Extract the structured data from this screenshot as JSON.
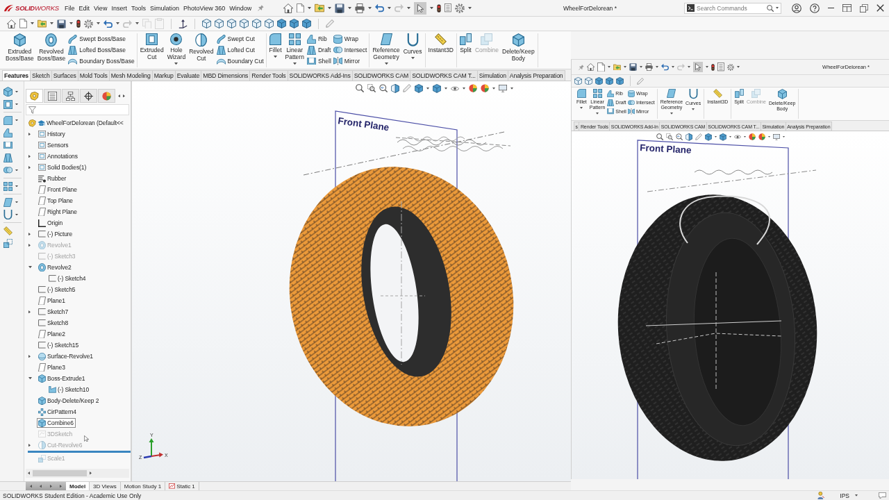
{
  "title_bar": {
    "logo": "**SOLID**WORKS",
    "menus": [
      "File",
      "Edit",
      "View",
      "Insert",
      "Tools",
      "Simulation",
      "PhotoView 360",
      "Window"
    ],
    "select_tool_active": true,
    "document_title": "WheelForDelorean *",
    "search": {
      "placeholder": "Search Commands"
    }
  },
  "command_manager": {
    "groups": [
      {
        "tools": [
          {
            "kind": "large",
            "label": "Extruded Boss/Base",
            "dropdown": false,
            "disabled": false
          },
          {
            "kind": "large",
            "label": "Revolved Boss/Base",
            "dropdown": false,
            "disabled": false
          },
          {
            "kind": "stack",
            "items": [
              {
                "label": "Swept Boss/Base",
                "disabled": false
              },
              {
                "label": "Lofted Boss/Base",
                "disabled": false
              },
              {
                "label": "Boundary Boss/Base",
                "disabled": false
              }
            ]
          }
        ]
      },
      {
        "tools": [
          {
            "kind": "large",
            "label": "Extruded Cut",
            "dropdown": false,
            "disabled": false
          },
          {
            "kind": "large",
            "label": "Hole Wizard",
            "dropdown": true,
            "disabled": false
          },
          {
            "kind": "large",
            "label": "Revolved Cut",
            "dropdown": false,
            "disabled": false
          },
          {
            "kind": "stack",
            "items": [
              {
                "label": "Swept Cut",
                "disabled": false
              },
              {
                "label": "Lofted Cut",
                "disabled": false
              },
              {
                "label": "Boundary Cut",
                "disabled": false
              }
            ]
          }
        ]
      },
      {
        "tools": [
          {
            "kind": "large",
            "label": "Fillet",
            "dropdown": true,
            "disabled": false
          },
          {
            "kind": "large",
            "label": "Linear Pattern",
            "dropdown": true,
            "disabled": false
          },
          {
            "kind": "stack",
            "items": [
              {
                "label": "Rib",
                "disabled": false
              },
              {
                "label": "Draft",
                "disabled": false
              },
              {
                "label": "Shell",
                "disabled": false
              }
            ]
          },
          {
            "kind": "stack",
            "items": [
              {
                "label": "Wrap",
                "disabled": false
              },
              {
                "label": "Intersect",
                "disabled": false
              },
              {
                "label": "Mirror",
                "disabled": false
              }
            ]
          }
        ]
      },
      {
        "tools": [
          {
            "kind": "large",
            "label": "Reference Geometry",
            "dropdown": true,
            "disabled": false
          },
          {
            "kind": "large",
            "label": "Curves",
            "dropdown": true,
            "disabled": false
          }
        ]
      },
      {
        "tools": [
          {
            "kind": "large",
            "label": "Instant3D",
            "dropdown": false,
            "disabled": false
          }
        ]
      },
      {
        "tools": [
          {
            "kind": "large",
            "label": "Split",
            "dropdown": false,
            "disabled": false
          },
          {
            "kind": "large",
            "label": "Combine",
            "dropdown": false,
            "disabled": true
          },
          {
            "kind": "large",
            "label": "Delete/Keep Body",
            "dropdown": false,
            "disabled": false
          }
        ]
      }
    ]
  },
  "tabs": [
    {
      "label": "Features",
      "selected": true
    },
    {
      "label": "Sketch",
      "selected": false
    },
    {
      "label": "Surfaces",
      "selected": false
    },
    {
      "label": "Mold Tools",
      "selected": false
    },
    {
      "label": "Mesh Modeling",
      "selected": false
    },
    {
      "label": "Markup",
      "selected": false
    },
    {
      "label": "Evaluate",
      "selected": false
    },
    {
      "label": "MBD Dimensions",
      "selected": false
    },
    {
      "label": "Render Tools",
      "selected": false
    },
    {
      "label": "SOLIDWORKS Add-Ins",
      "selected": false
    },
    {
      "label": "SOLIDWORKS CAM",
      "selected": false
    },
    {
      "label": "SOLIDWORKS CAM T...",
      "selected": false
    },
    {
      "label": "Simulation",
      "selected": false
    },
    {
      "label": "Analysis Preparation",
      "selected": false
    }
  ],
  "feature_manager": {
    "tabs": [
      {
        "selected": true
      },
      {
        "selected": false
      },
      {
        "selected": false
      },
      {
        "selected": false
      },
      {
        "selected": false
      }
    ],
    "root": {
      "kind": "part",
      "label": "WheelForDelorean (Default<<",
      "selected": false,
      "suppressed": false,
      "children": [
        {
          "kind": "folder",
          "label": "History",
          "expanded": false,
          "selected": false,
          "suppressed": false
        },
        {
          "kind": "folder",
          "label": "Sensors",
          "selected": false,
          "suppressed": false
        },
        {
          "kind": "folder",
          "label": "Annotations",
          "expanded": false,
          "selected": false,
          "suppressed": false
        },
        {
          "kind": "folder",
          "label": "Solid Bodies(1)",
          "expanded": false,
          "selected": false,
          "suppressed": false
        },
        {
          "kind": "material",
          "label": "Rubber",
          "selected": false,
          "suppressed": false
        },
        {
          "kind": "plane",
          "label": "Front Plane",
          "selected": false,
          "suppressed": false
        },
        {
          "kind": "plane",
          "label": "Top Plane",
          "selected": false,
          "suppressed": false
        },
        {
          "kind": "plane",
          "label": "Right Plane",
          "selected": false,
          "suppressed": false
        },
        {
          "kind": "origin",
          "label": "Origin",
          "selected": false,
          "suppressed": false
        },
        {
          "kind": "sketch",
          "label": "(-) Picture",
          "expanded": false,
          "selected": false,
          "suppressed": false
        },
        {
          "kind": "revolve",
          "label": "Revolve1",
          "expanded": false,
          "selected": false,
          "suppressed": true
        },
        {
          "kind": "sketch",
          "label": "(-) Sketch3",
          "selected": false,
          "suppressed": true
        },
        {
          "kind": "revolve",
          "label": "Revolve2",
          "expanded": true,
          "selected": false,
          "suppressed": false,
          "children": [
            {
              "kind": "sketch",
              "label": "(-) Sketch4",
              "selected": false,
              "suppressed": false
            }
          ]
        },
        {
          "kind": "sketch",
          "label": "(-) Sketch5",
          "selected": false,
          "suppressed": false
        },
        {
          "kind": "plane",
          "label": "Plane1",
          "selected": false,
          "suppressed": false
        },
        {
          "kind": "sketch",
          "label": "Sketch7",
          "expanded": false,
          "selected": false,
          "suppressed": false
        },
        {
          "kind": "sketch",
          "label": "Sketch8",
          "selected": false,
          "suppressed": false
        },
        {
          "kind": "plane",
          "label": "Plane2",
          "selected": false,
          "suppressed": false
        },
        {
          "kind": "sketch",
          "label": "(-) Sketch15",
          "selected": false,
          "suppressed": false
        },
        {
          "kind": "surface",
          "label": "Surface-Revolve1",
          "expanded": false,
          "selected": false,
          "suppressed": false
        },
        {
          "kind": "plane",
          "label": "Plane3",
          "selected": false,
          "suppressed": false
        },
        {
          "kind": "extrude",
          "label": "Boss-Extrude1",
          "expanded": true,
          "selected": false,
          "suppressed": false,
          "children": [
            {
              "kind": "sketch_profile",
              "label": "(-) Sketch10",
              "selected": false,
              "suppressed": false
            }
          ]
        },
        {
          "kind": "delete_body",
          "label": "Body-Delete/Keep 2",
          "selected": false,
          "suppressed": false
        },
        {
          "kind": "pattern",
          "label": "CirPattern4",
          "selected": false,
          "suppressed": false
        },
        {
          "kind": "combine",
          "label": "Combine6",
          "selected": true,
          "suppressed": false
        },
        {
          "kind": "sketch3d",
          "label": "3DSketch",
          "selected": false,
          "suppressed": true
        },
        {
          "kind": "cut",
          "label": "Cut-Revolve6",
          "expanded": false,
          "selected": false,
          "suppressed": true
        },
        {
          "kind": "rollback_bar"
        },
        {
          "kind": "scale",
          "label": "Scale1",
          "selected": false,
          "suppressed": true
        }
      ]
    }
  },
  "viewport": {
    "plane_label": "Front Plane",
    "triad": {
      "x": "X",
      "y": "Y",
      "z": "Z"
    }
  },
  "bottom_tabs": [
    {
      "label": "Model",
      "selected": true
    },
    {
      "label": "3D Views",
      "selected": false
    },
    {
      "label": "Motion Study 1",
      "selected": false
    },
    {
      "label": "Static 1",
      "selected": false
    }
  ],
  "status_bar": {
    "text": "SOLIDWORKS Student Edition - Academic Use Only",
    "units": "IPS"
  },
  "inset": {
    "select_tool_active": true,
    "document_title": "WheelForDelorean *",
    "command_manager": {
      "groups": [
        {
          "tools": [
            {
              "kind": "large",
              "label": "Fillet",
              "dropdown": true,
              "disabled": false
            },
            {
              "kind": "large",
              "label": "Linear Pattern",
              "dropdown": true,
              "disabled": false
            },
            {
              "kind": "stack",
              "items": [
                {
                  "label": "Rib",
                  "disabled": false
                },
                {
                  "label": "Draft",
                  "disabled": false
                },
                {
                  "label": "Shell",
                  "disabled": false
                }
              ]
            },
            {
              "kind": "stack",
              "items": [
                {
                  "label": "Wrap",
                  "disabled": false
                },
                {
                  "label": "Intersect",
                  "disabled": false
                },
                {
                  "label": "Mirror",
                  "disabled": false
                }
              ]
            }
          ]
        },
        {
          "tools": [
            {
              "kind": "large",
              "label": "Reference Geometry",
              "dropdown": true,
              "disabled": false
            },
            {
              "kind": "large",
              "label": "Curves",
              "dropdown": true,
              "disabled": false
            }
          ]
        },
        {
          "tools": [
            {
              "kind": "large",
              "label": "Instant3D",
              "dropdown": false,
              "disabled": false
            }
          ]
        },
        {
          "tools": [
            {
              "kind": "large",
              "label": "Split",
              "dropdown": false,
              "disabled": false
            },
            {
              "kind": "large",
              "label": "Combine",
              "dropdown": false,
              "disabled": true
            },
            {
              "kind": "large",
              "label": "Delete/Keep Body",
              "dropdown": false,
              "disabled": false
            }
          ]
        }
      ]
    },
    "tabs": [
      {
        "label": "s",
        "selected": false
      },
      {
        "label": "Render Tools",
        "selected": false
      },
      {
        "label": "SOLIDWORKS Add-In",
        "selected": false
      },
      {
        "label": "SOLIDWORKS CAM",
        "selected": false
      },
      {
        "label": "SOLIDWORKS CAM T...",
        "selected": false
      },
      {
        "label": "Simulation",
        "selected": false
      },
      {
        "label": "Analysis Preparation",
        "selected": false
      }
    ],
    "plane_label": "Front Plane"
  }
}
